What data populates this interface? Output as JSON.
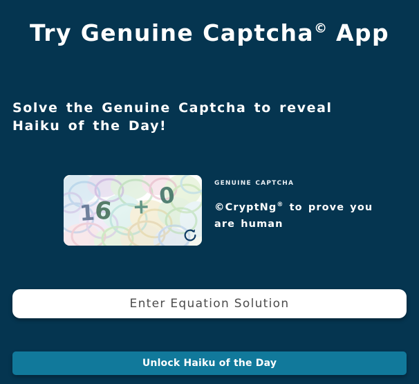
{
  "theme": {
    "background": "#053550",
    "accent": "#11799b",
    "text": "#ffffff",
    "input_background": "#ffffff",
    "input_placeholder_color": "#4b4b4b"
  },
  "header": {
    "title_main": "Try Genuine Captcha",
    "title_sup": "©",
    "title_tail": " App"
  },
  "instructions": {
    "text": "Solve the Genuine Captcha to reveal Haiku of the Day!"
  },
  "captcha": {
    "image_alt": "captcha-equation-image",
    "equation_text": "16 + 0",
    "equation_digits": [
      "1",
      "6",
      "+",
      "0"
    ],
    "brand_label": "Genuine Captcha",
    "description_prefix": "©CryptNg",
    "description_sup": "®",
    "description_suffix": " to prove you are human",
    "refresh_icon": "refresh-icon",
    "noise_colors": [
      "#c9a6d8",
      "#a8c8e8",
      "#bfe0a8",
      "#e8b8c8",
      "#d8d0a0",
      "#a0d8cf",
      "#c7b9e2",
      "#e5c9a8"
    ]
  },
  "form": {
    "answer_placeholder": "Enter Equation Solution",
    "answer_value": "",
    "submit_label": "Unlock Haiku of the Day"
  }
}
